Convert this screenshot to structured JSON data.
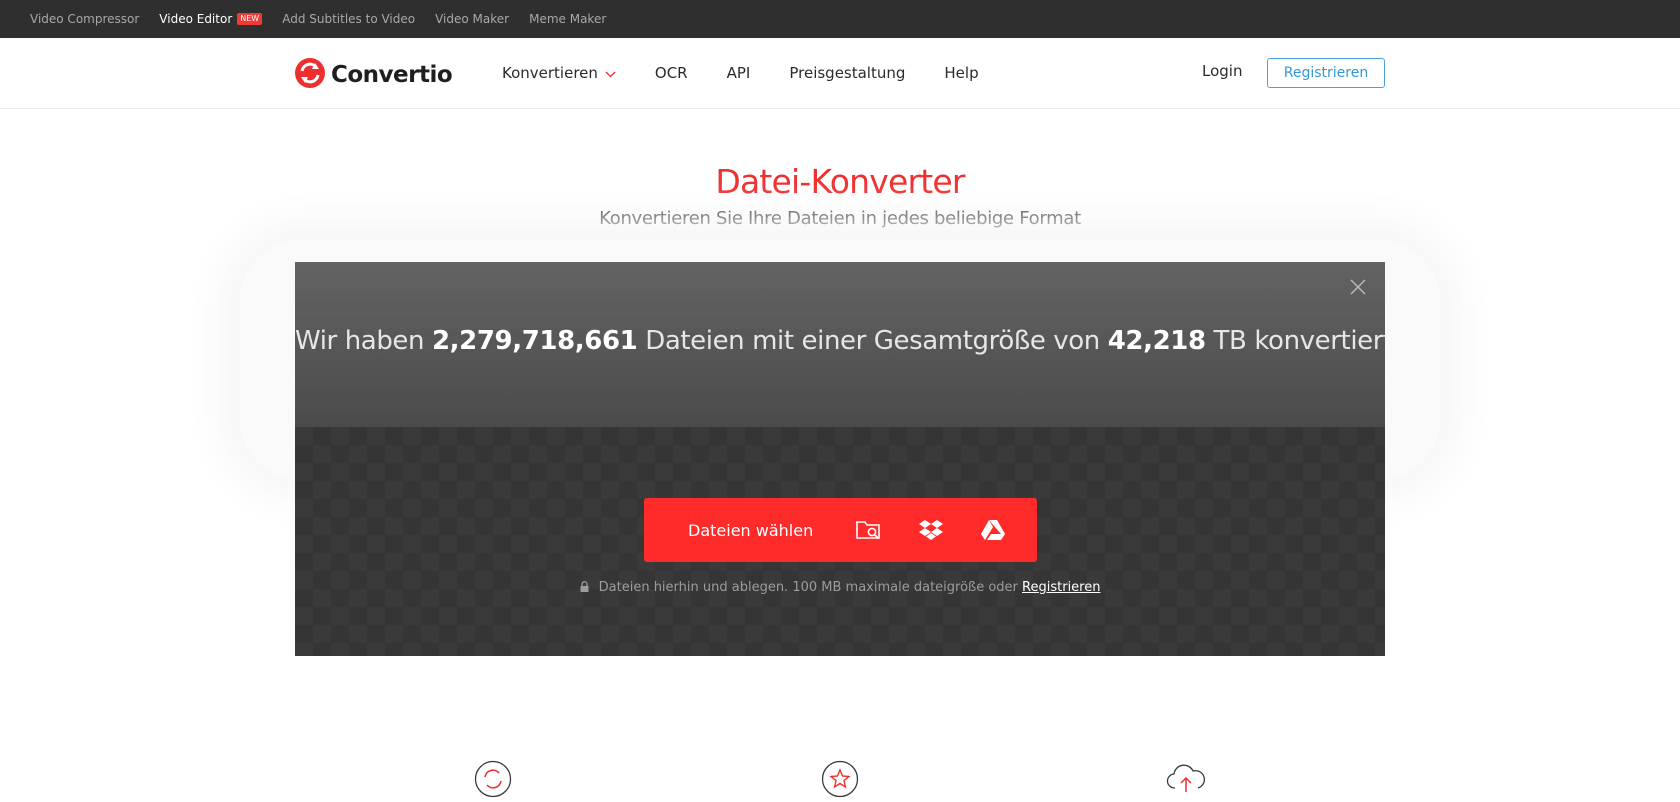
{
  "topbar": {
    "links": [
      {
        "label": "Video Compressor"
      },
      {
        "label": "Video Editor",
        "badge": "NEW"
      },
      {
        "label": "Add Subtitles to Video"
      },
      {
        "label": "Video Maker"
      },
      {
        "label": "Meme Maker"
      }
    ]
  },
  "header": {
    "logo_text": "Convertio",
    "nav": [
      "Konvertieren",
      "OCR",
      "API",
      "Preisgestaltung",
      "Help"
    ],
    "login": "Login",
    "register": "Registrieren"
  },
  "hero": {
    "title": "Datei-Konverter",
    "subtitle": "Konvertieren Sie Ihre Dateien in jedes beliebige Format"
  },
  "stats": {
    "prefix": "Wir haben",
    "files": "2,279,718,661",
    "middle": "Dateien mit einer Gesamtgröße von",
    "size": "42,218",
    "suffix": "TB konvertiert"
  },
  "upload": {
    "choose_label": "Dateien wählen",
    "hint": "Dateien hierhin und ablegen. 100 MB maximale dateigröße oder",
    "hint_link": "Registrieren"
  },
  "colors": {
    "accent": "#ff2b2b",
    "title_red": "#ef2f2f",
    "register_blue": "#3199d6",
    "topbar_bg": "#2f2f2f"
  },
  "icons": {
    "close": "close-icon",
    "folder_search": "folder-search-icon",
    "dropbox": "dropbox-icon",
    "google_drive": "google-drive-icon",
    "lock": "lock-icon",
    "features": [
      "convert-refresh-icon",
      "star-icon",
      "cloud-upload-icon"
    ]
  }
}
